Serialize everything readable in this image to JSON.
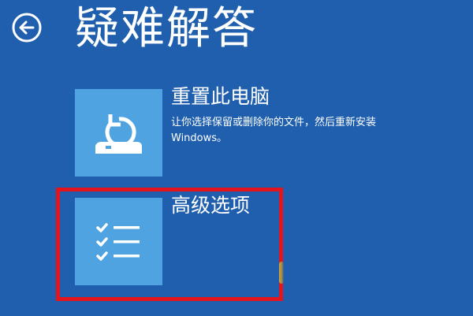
{
  "page": {
    "title": "疑难解答"
  },
  "icons": {
    "back": "back-arrow-icon",
    "reset": "reset-pc-icon",
    "advanced": "checklist-icon"
  },
  "colors": {
    "background": "#1f5fae",
    "tile": "#4ea3e0",
    "text": "#ffffff",
    "highlight": "#e3141c"
  },
  "options": [
    {
      "title": "重置此电脑",
      "description": "让你选择保留或删除你的文件，然后重新安装 Windows。"
    },
    {
      "title": "高级选项",
      "description": ""
    }
  ]
}
